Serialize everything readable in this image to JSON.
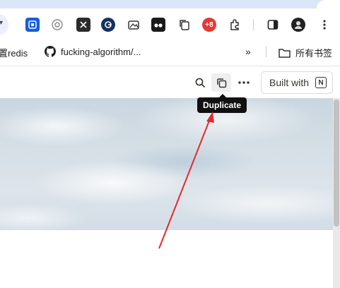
{
  "bookmarks": {
    "items": [
      {
        "label": "置redis",
        "icon": "none"
      },
      {
        "label": "fucking-algorithm/...",
        "icon": "github-icon"
      }
    ],
    "overflow_label": "»",
    "folder_label": "所有书签"
  },
  "toolbar": {
    "extensions": [
      "bitwarden-icon",
      "openai-icon",
      "x-icon",
      "grammarly-icon",
      "image-icon",
      "tampermonkey-icon",
      "copy-icon",
      "ublock-icon",
      "puzzle-icon"
    ],
    "ublock_badge": "+8"
  },
  "page_header": {
    "built_with_label": "Built with",
    "notion_logo_letter": "N"
  },
  "tooltip": {
    "text": "Duplicate"
  },
  "colors": {
    "annotation_arrow": "#e22b2b",
    "tooltip_bg": "#111111"
  }
}
